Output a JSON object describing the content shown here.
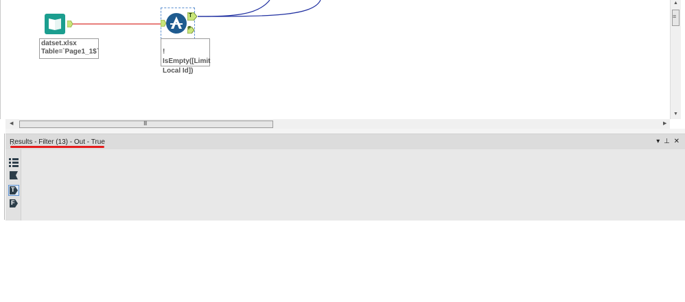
{
  "canvas": {
    "input_tool": {
      "icon": "book-icon",
      "color": "#1b9e8f",
      "label": "datset.xlsx\nTable=`Page1_1$`"
    },
    "filter_tool": {
      "icon": "filter-icon",
      "color": "#1f5b8f",
      "true_anchor": "T",
      "false_anchor": "F",
      "label": "! IsEmpty([Limit\nLocal Id])"
    },
    "wire_colors": {
      "input_to_filter": "#d9302c",
      "filter_out": "#1f2fa0"
    }
  },
  "scrollbars": {
    "vertical_grip": "≡",
    "horizontal_grip": "III"
  },
  "results": {
    "title": "Results - Filter (13) - Out - True",
    "underline_color": "#e51b1b",
    "header_buttons": {
      "dropdown": "▾",
      "pin": "⊥",
      "close": "✕"
    },
    "side_icons": [
      {
        "name": "more-icon",
        "glyph": "⋯"
      },
      {
        "name": "list-icon"
      },
      {
        "name": "flag-icon"
      },
      {
        "name": "true-anchor-icon",
        "glyph": "T"
      },
      {
        "name": "false-anchor-icon",
        "glyph": "F"
      }
    ]
  }
}
